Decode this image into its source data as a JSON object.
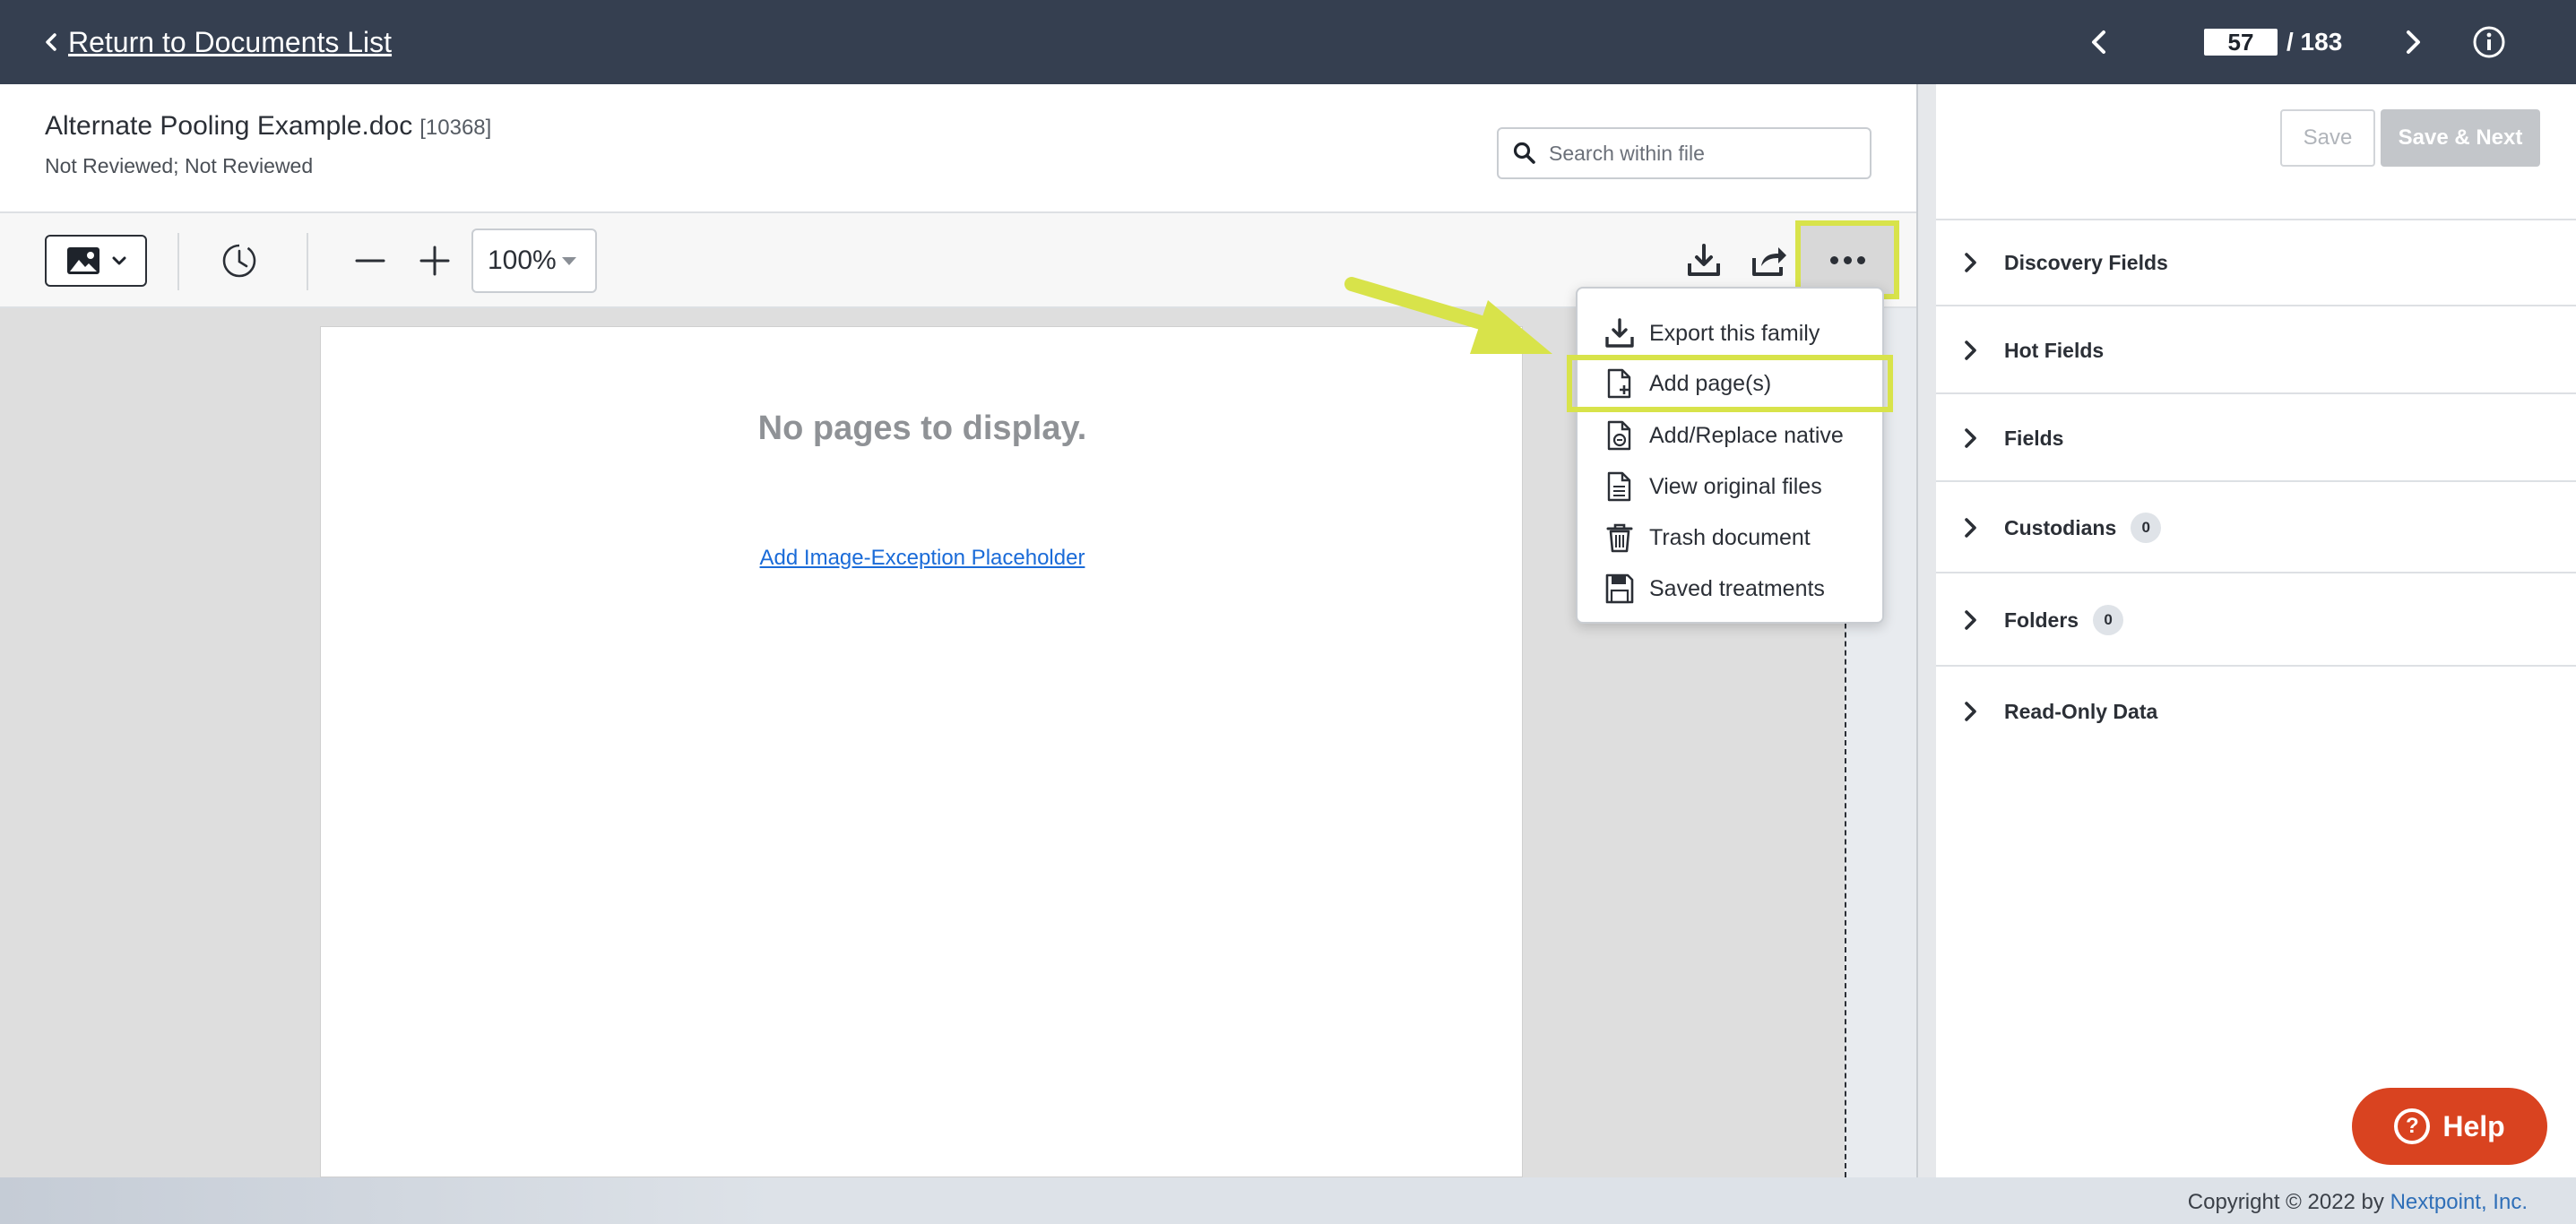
{
  "topbar": {
    "back_label": "Return to Documents List",
    "page_current": "57",
    "page_total": "/ 183"
  },
  "document": {
    "title": "Alternate Pooling Example.doc",
    "id": "[10368]",
    "status": "Not Reviewed; Not Reviewed"
  },
  "search": {
    "placeholder": "Search within file"
  },
  "toolbar": {
    "zoom": "100%"
  },
  "viewer": {
    "empty_message": "No pages to display.",
    "placeholder_link": "Add Image-Exception Placeholder"
  },
  "menu": {
    "items": [
      {
        "label": "Export this family",
        "icon": "download-icon"
      },
      {
        "label": "Add page(s)",
        "icon": "add-page-icon"
      },
      {
        "label": "Add/Replace native",
        "icon": "replace-native-icon"
      },
      {
        "label": "View original files",
        "icon": "file-icon"
      },
      {
        "label": "Trash document",
        "icon": "trash-icon"
      },
      {
        "label": "Saved treatments",
        "icon": "save-icon"
      }
    ]
  },
  "panel": {
    "save_label": "Save",
    "save_next_label": "Save & Next",
    "sections": [
      {
        "label": "Discovery Fields",
        "badge": null
      },
      {
        "label": "Hot Fields",
        "badge": null
      },
      {
        "label": "Fields",
        "badge": null
      },
      {
        "label": "Custodians",
        "badge": "0"
      },
      {
        "label": "Folders",
        "badge": "0"
      },
      {
        "label": "Read-Only Data",
        "badge": null
      }
    ]
  },
  "help": {
    "label": "Help"
  },
  "footer": {
    "copyright_prefix": "Copyright © 2022 by ",
    "company": "Nextpoint, Inc."
  },
  "colors": {
    "topbar": "#353f50",
    "highlight": "#d8e34a",
    "help": "#d94320",
    "link": "#1a6bd8"
  }
}
